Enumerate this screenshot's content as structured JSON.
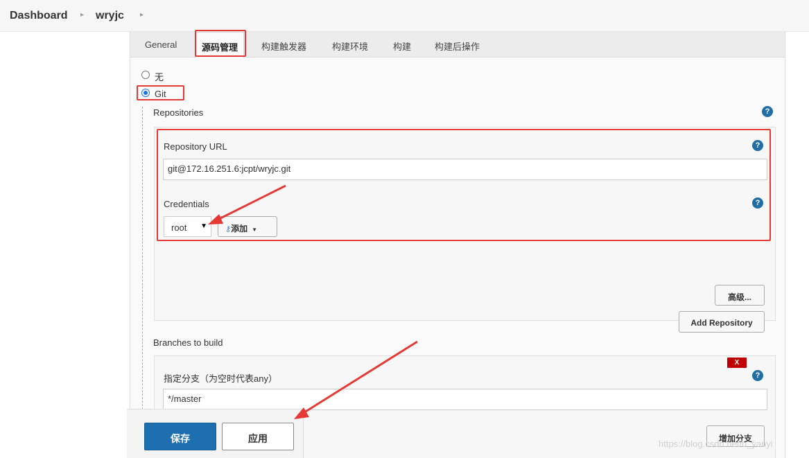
{
  "breadcrumb": {
    "items": [
      "Dashboard",
      "wryjc"
    ]
  },
  "tabs": [
    "General",
    "源码管理",
    "构建触发器",
    "构建环境",
    "构建",
    "构建后操作"
  ],
  "active_tab": "源码管理",
  "scm": {
    "options": [
      {
        "label": "无",
        "checked": false
      },
      {
        "label": "Git",
        "checked": true
      }
    ]
  },
  "repositories": {
    "section_label": "Repositories",
    "url_label": "Repository URL",
    "url_value": "git@172.16.251.6:jcpt/wryjc.git",
    "credentials_label": "Credentials",
    "credentials_value": "root",
    "add_label": "添加",
    "advanced_label": "高级...",
    "add_repository_label": "Add Repository"
  },
  "branches": {
    "section_label": "Branches to build",
    "delete_label": "X",
    "specifier_label": "指定分支（为空时代表any）",
    "specifier_value": "*/master",
    "add_branch_label": "增加分支"
  },
  "footer": {
    "save_label": "保存",
    "apply_label": "应用"
  },
  "icons": {
    "help": "question-mark-icon",
    "key": "key-icon",
    "chevron": "chevron-down-icon"
  },
  "colors": {
    "primary": "#1d6fb0",
    "help": "#1f6ea6",
    "annotation": "#e53935",
    "delete": "#c00000"
  },
  "help_glyph": "?",
  "watermark": "https://blog.csdn.net/u_yanyi"
}
